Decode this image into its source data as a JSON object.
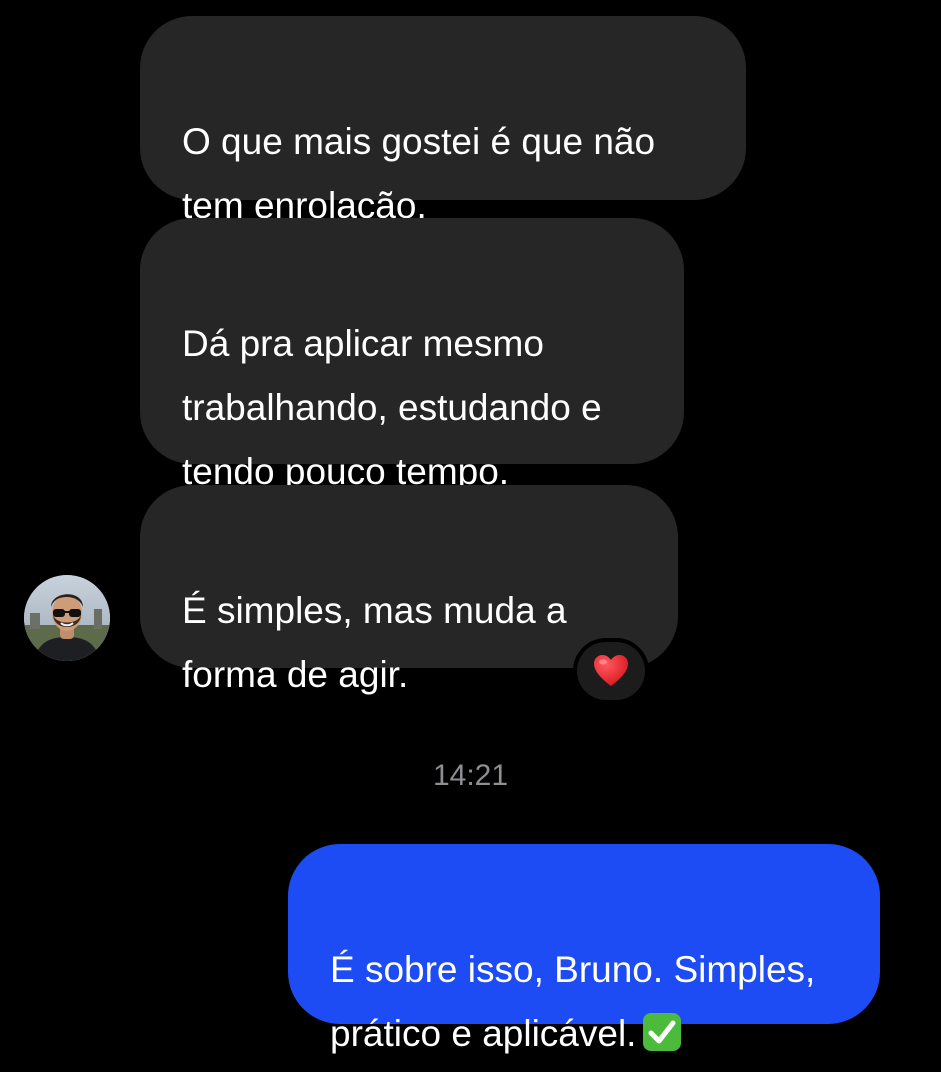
{
  "theme": {
    "background": "#000000",
    "incoming_bubble": "#262626",
    "outgoing_bubble": "#1e4cf4",
    "text": "#ffffff",
    "timestamp_text": "#8e8e93"
  },
  "conversation": {
    "messages": [
      {
        "direction": "incoming",
        "text": "O que mais gostei é que não\ntem enrolação."
      },
      {
        "direction": "incoming",
        "text": "Dá pra aplicar mesmo\ntrabalhando, estudando e\ntendo pouco tempo."
      },
      {
        "direction": "incoming",
        "text": "É simples, mas muda a\nforma de agir.",
        "reaction": "heart-emoji"
      },
      {
        "direction": "outgoing",
        "text": "É sobre isso, Bruno. Simples,\nprático e aplicável.",
        "trailing_icon": "check-mark-emoji"
      }
    ],
    "timestamp": "14:21",
    "sender_avatar": "avatar-photo"
  }
}
